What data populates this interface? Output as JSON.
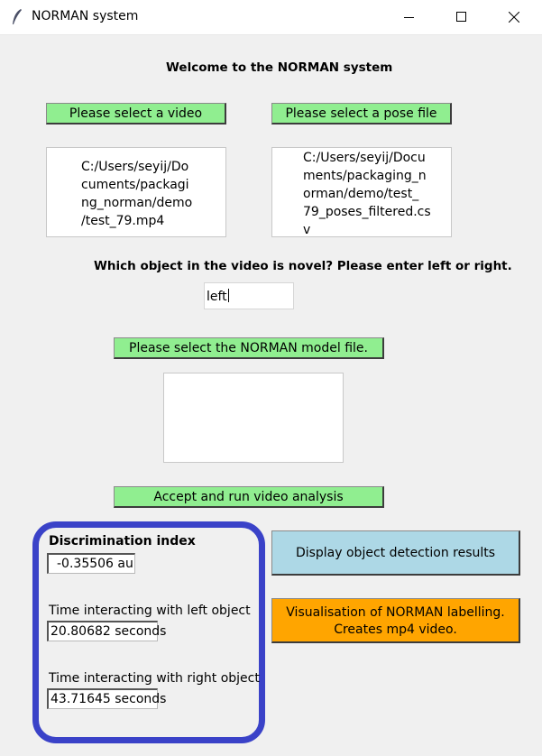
{
  "window": {
    "title": "NORMAN system",
    "icon": "feather-icon"
  },
  "header": {
    "welcome": "Welcome to the NORMAN system"
  },
  "video": {
    "button_label": "Please select a video",
    "path_lines": [
      "C:/Users/seyij/Do",
      "cuments/packagi",
      "ng_norman/demo",
      "/test_79.mp4"
    ]
  },
  "pose": {
    "button_label": "Please select a pose file",
    "path_lines": [
      "C:/Users/seyij/Docu",
      "ments/packaging_n",
      "orman/demo/test_",
      "79_poses_filtered.cs",
      "v"
    ]
  },
  "novel": {
    "question": "Which object in the video is novel? Please enter left or right.",
    "value": "left"
  },
  "model": {
    "button_label": "Please select the NORMAN model file.",
    "path": ""
  },
  "run": {
    "button_label": "Accept and run video analysis"
  },
  "results": {
    "discrimination_label": "Discrimination index",
    "discrimination_value": "-0.35506 au",
    "left_label": "Time interacting with left object",
    "left_value": "20.80682 seconds",
    "right_label": "Time interacting with right object",
    "right_value": "43.71645 seconds"
  },
  "actions": {
    "detection_label": "Display object detection results",
    "visualisation_line1": "Visualisation of NORMAN labelling.",
    "visualisation_line2": "Creates mp4 video."
  },
  "colors": {
    "green_button": "#90ee90",
    "blue_button": "#add8e6",
    "orange_button": "#ffa500",
    "highlight_frame": "#3a42c8",
    "window_bg": "#f0f0f0"
  }
}
